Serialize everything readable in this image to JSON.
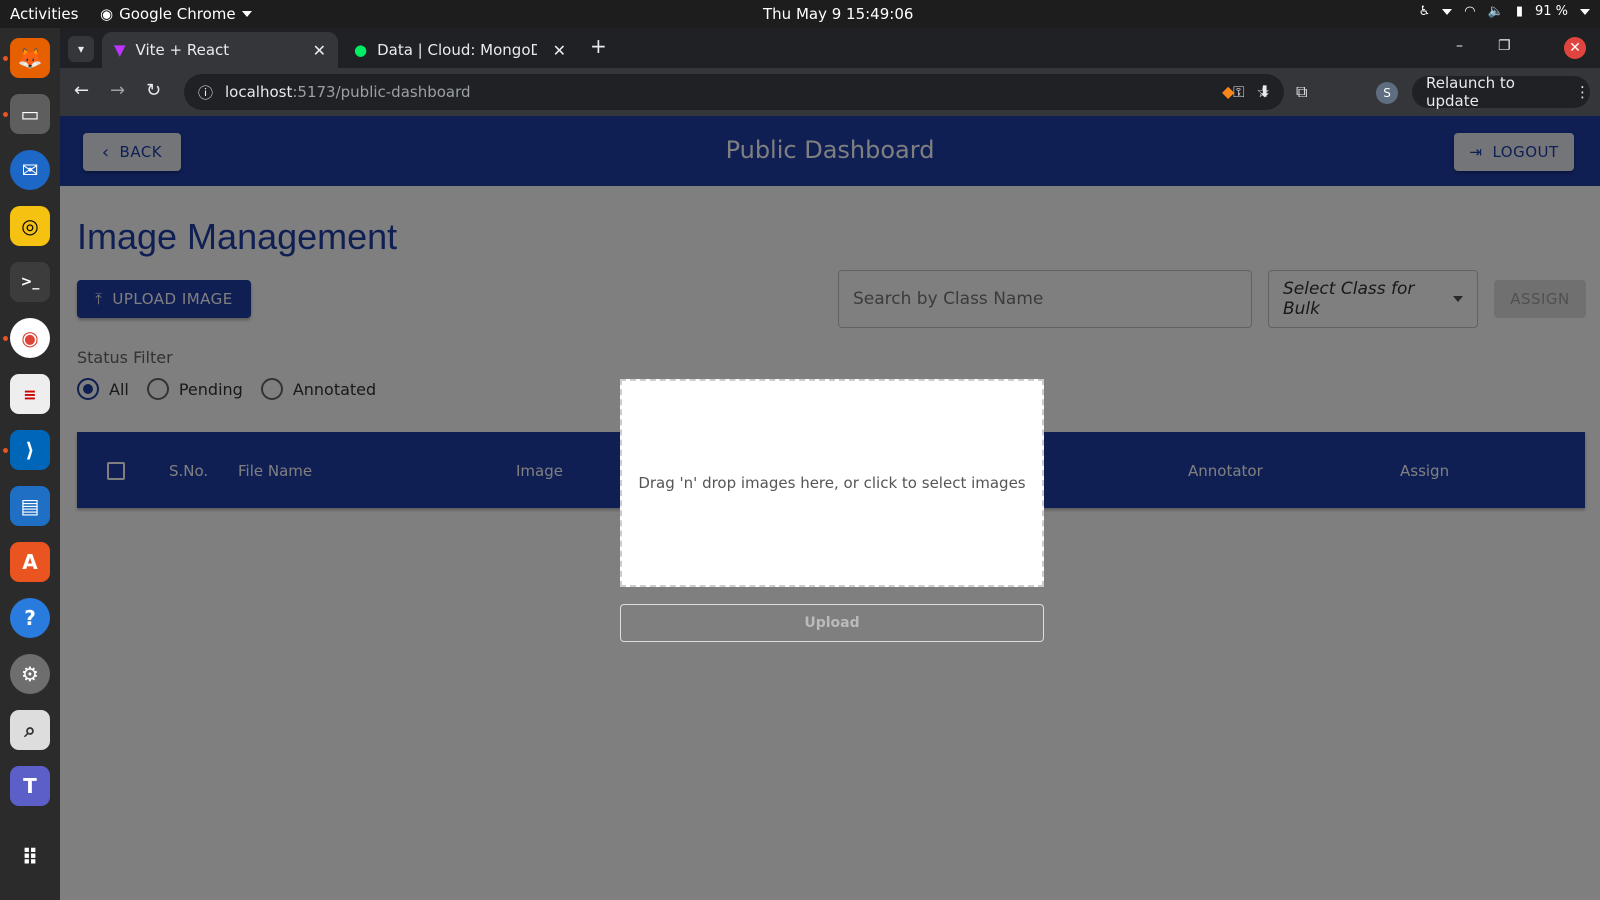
{
  "os": {
    "activities": "Activities",
    "app_name": "Google Chrome",
    "clock": "Thu May 9  15:49:06",
    "battery": "91 %"
  },
  "browser": {
    "tabs": [
      {
        "title": "Vite + React",
        "active": true
      },
      {
        "title": "Data | Cloud: MongoDB C",
        "active": false
      }
    ],
    "url_host": "localhost",
    "url_path": ":5173/public-dashboard",
    "relaunch": "Relaunch to update",
    "profile_initial": "S"
  },
  "appbar": {
    "back": "BACK",
    "title": "Public Dashboard",
    "logout": "LOGOUT",
    "color": "#1e3ea8"
  },
  "page": {
    "heading": "Image Management",
    "upload_image": "UPLOAD IMAGE",
    "search_placeholder": "Search by Class Name",
    "select_placeholder": "Select Class for Bulk",
    "assign": "ASSIGN",
    "status_filter_label": "Status Filter",
    "filters": [
      {
        "label": "All",
        "checked": true
      },
      {
        "label": "Pending",
        "checked": false
      },
      {
        "label": "Annotated",
        "checked": false
      }
    ],
    "columns": {
      "sno": "S.No.",
      "file_name": "File Name",
      "image": "Image",
      "annotator": "Annotator",
      "assign": "Assign"
    }
  },
  "modal": {
    "dropzone_text": "Drag 'n' drop images here, or click to select images",
    "upload": "Upload"
  }
}
